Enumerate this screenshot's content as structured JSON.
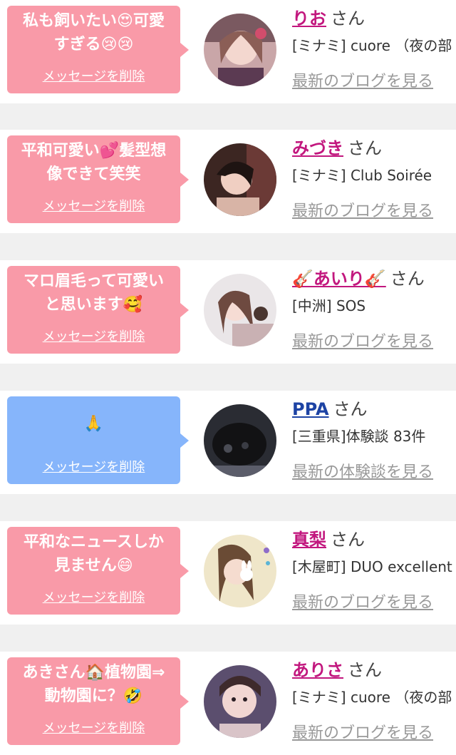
{
  "delete_label": "メッセージを削除",
  "san": "さん",
  "items": [
    {
      "message": [
        "私も飼いたい😍可愛",
        "すぎる😢😢"
      ],
      "name": "りお",
      "shop": "[ミナミ] cuore （夜の部",
      "link": "最新のブログを見る",
      "color": "pink"
    },
    {
      "message": [
        "平和可愛い💕髪型想",
        "像できて笑笑"
      ],
      "name": "みづき",
      "shop": "[ミナミ] Club Soirée",
      "link": "最新のブログを見る",
      "color": "pink"
    },
    {
      "message": [
        "マロ眉毛って可愛い",
        "と思います🥰"
      ],
      "name": "🎸あいり🎸",
      "shop": "[中洲] SOS",
      "link": "最新のブログを見る",
      "color": "pink"
    },
    {
      "message": [
        "🙏"
      ],
      "name": "PPA",
      "shop": "[三重県]体験談 83件",
      "link": "最新の体験談を見る",
      "color": "blue"
    },
    {
      "message": [
        "平和なニュースしか",
        "見ません😄"
      ],
      "name": "真梨",
      "shop": "[木屋町] DUO excellent",
      "link": "最新のブログを見る",
      "color": "pink"
    },
    {
      "message": [
        "あきさん🏠植物園⇒",
        "動物園に？🤣"
      ],
      "name": "ありさ",
      "shop": "[ミナミ] cuore （夜の部",
      "link": "最新のブログを見る",
      "color": "pink"
    }
  ],
  "colors": {
    "bubble_pink": "#f99aa8",
    "bubble_blue": "#86b5fb",
    "name_pink": "#c2177e",
    "name_blue": "#1d43a4"
  }
}
